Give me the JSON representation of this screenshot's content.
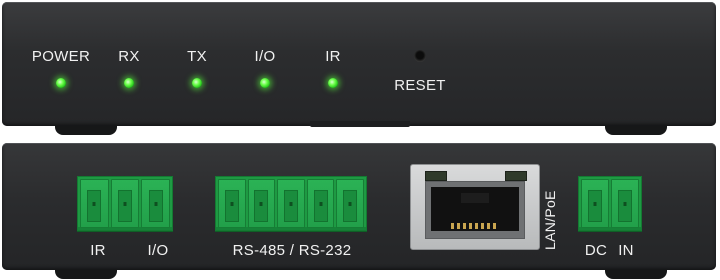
{
  "front_panel": {
    "indicators": [
      {
        "label": "POWER",
        "state": "on",
        "color": "#4dff3a"
      },
      {
        "label": "RX",
        "state": "on",
        "color": "#4dff3a"
      },
      {
        "label": "TX",
        "state": "on",
        "color": "#4dff3a"
      },
      {
        "label": "I/O",
        "state": "on",
        "color": "#4dff3a"
      },
      {
        "label": "IR",
        "state": "on",
        "color": "#4dff3a"
      }
    ],
    "reset_label": "RESET"
  },
  "rear_panel": {
    "ir_label": "IR",
    "io_label": "I/O",
    "serial_label": "RS-485 / RS-232",
    "lan_label": "LAN/PoE",
    "dc_label": "DC",
    "in_label": "IN"
  },
  "colors": {
    "chassis": "#2c2d2f",
    "terminal_block": "#1e9a43",
    "led_on": "#4dff3a",
    "label_text": "#f1f1f1"
  }
}
